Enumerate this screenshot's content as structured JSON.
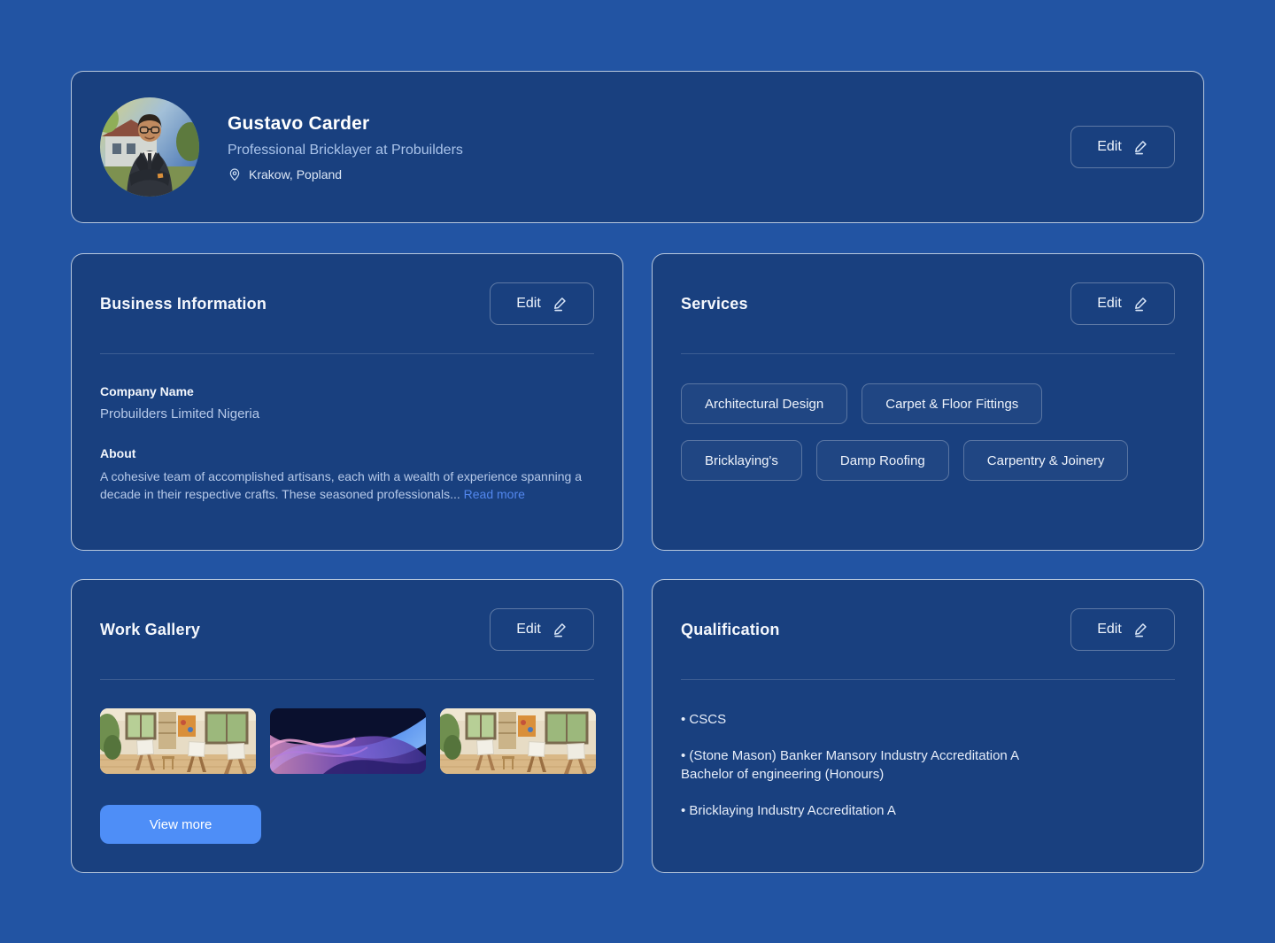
{
  "theme": {
    "page_bg": "#2254a3",
    "card_bg": "#19407f",
    "accent_button": "#4e8ef7",
    "link_color": "#5287ee",
    "text_primary": "#f4f8fe",
    "text_secondary": "#b6c9e9"
  },
  "profile": {
    "name": "Gustavo Carder",
    "headline": "Professional Bricklayer at Probuilders",
    "location": "Krakow, Popland",
    "edit_label": "Edit",
    "avatar": "man-in-suit-portrait"
  },
  "business_info": {
    "title": "Business Information",
    "edit_label": "Edit",
    "company_name_label": "Company Name",
    "company_name_value": "Probuilders Limited Nigeria",
    "about_label": "About",
    "about_text": "A cohesive team of accomplished artisans, each with a wealth of experience spanning a decade in their respective crafts. These seasoned professionals... ",
    "read_more_label": "Read more"
  },
  "services": {
    "title": "Services",
    "edit_label": "Edit",
    "tags": [
      "Architectural Design",
      "Carpet & Floor Fittings",
      "Bricklaying's",
      "Damp Roofing",
      "Carpentry & Joinery"
    ]
  },
  "work_gallery": {
    "title": "Work Gallery",
    "edit_label": "Edit",
    "images": [
      "art-studio-photo",
      "abstract-blue-waves-graphic",
      "art-studio-photo"
    ],
    "view_more_label": "View more"
  },
  "qualification": {
    "title": "Qualification",
    "edit_label": "Edit",
    "items": [
      {
        "line1": "CSCS",
        "line2": ""
      },
      {
        "line1": "(Stone Mason) Banker Mansory Industry Accreditation A",
        "line2": "Bachelor of engineering (Honours)"
      },
      {
        "line1": "Bricklaying Industry Accreditation A",
        "line2": ""
      }
    ]
  }
}
